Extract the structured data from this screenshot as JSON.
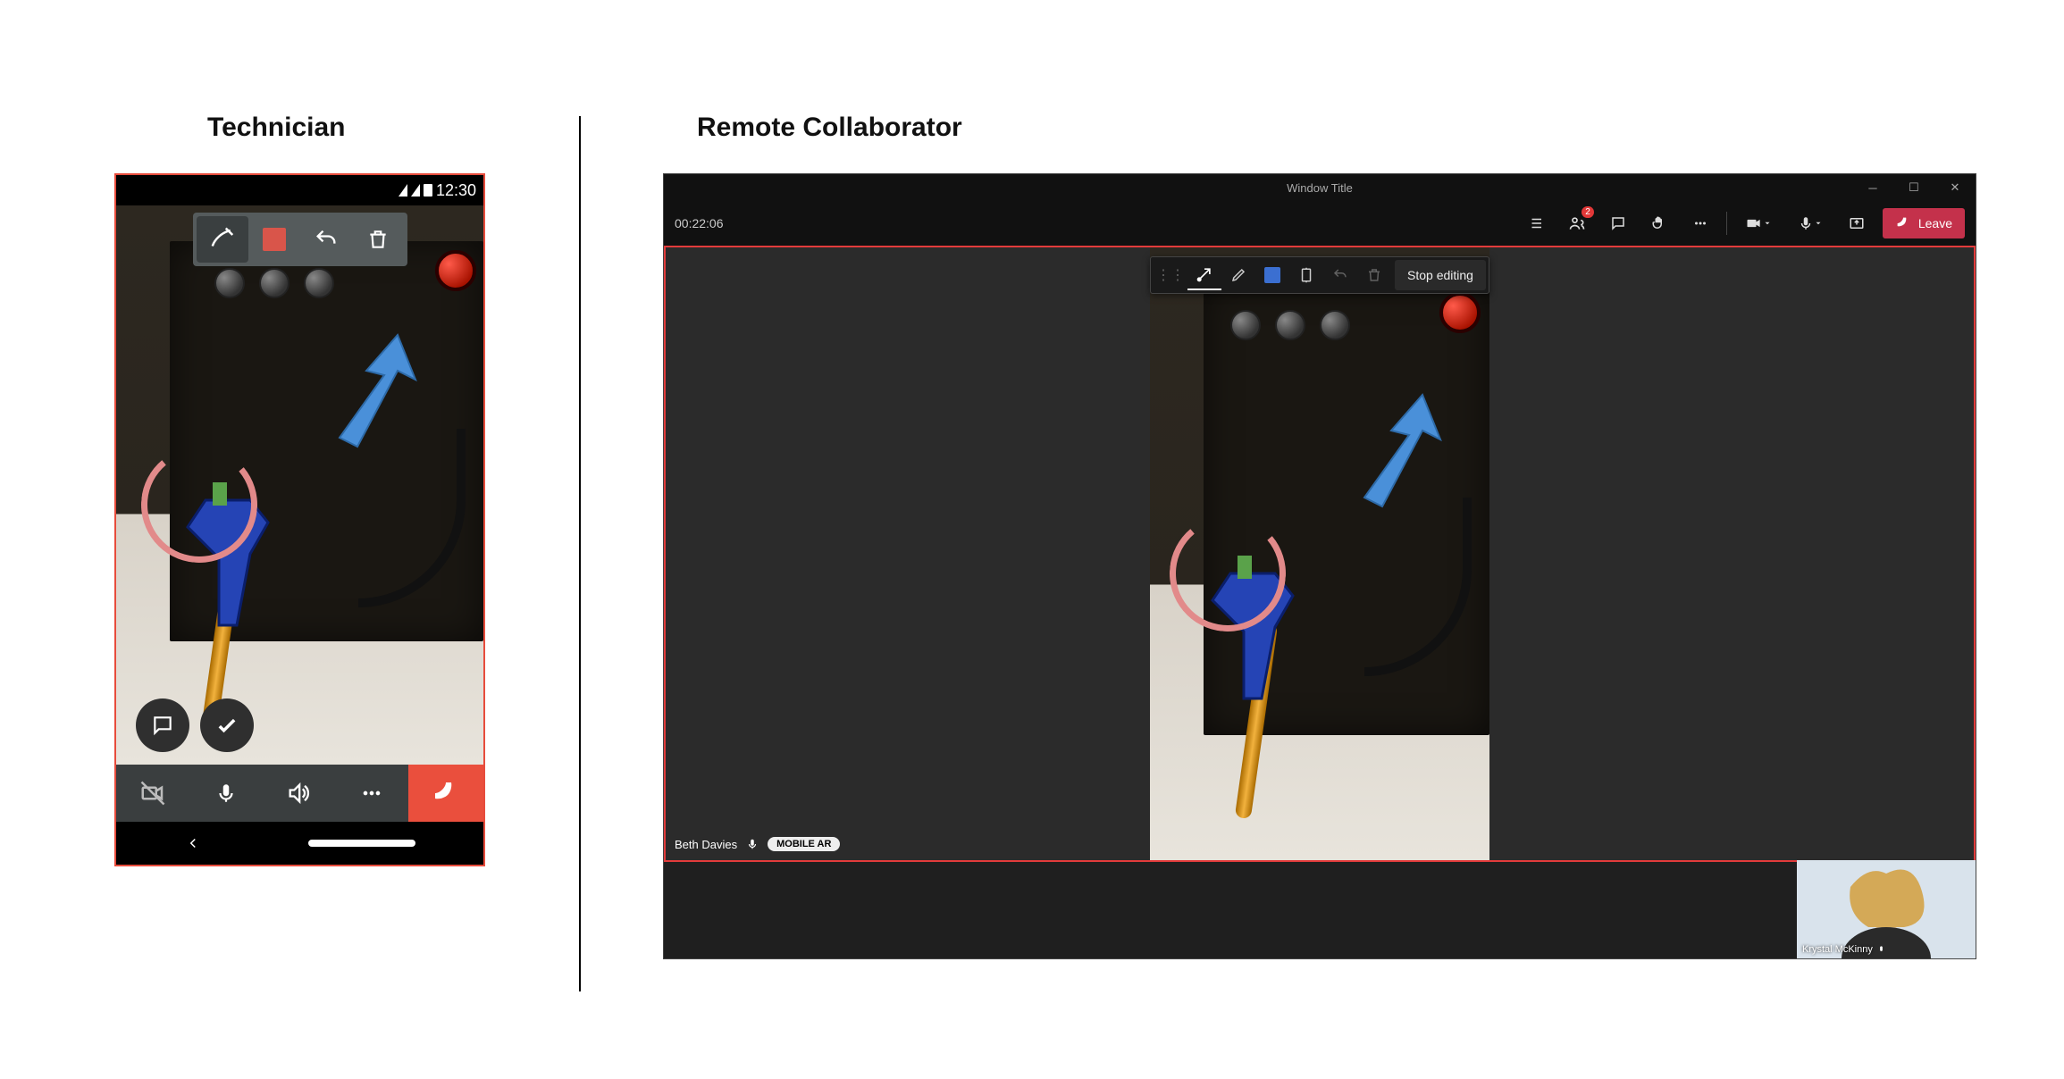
{
  "labels": {
    "technician": "Technician",
    "collaborator": "Remote Collaborator"
  },
  "phone": {
    "status_time": "12:30",
    "annotation_color": "#d9554a"
  },
  "teams": {
    "window_title": "Window Title",
    "call_time": "00:22:06",
    "badge_count": "2",
    "leave_label": "Leave",
    "stop_editing": "Stop editing",
    "edit_color": "#3b6fd1",
    "participant_name": "Beth Davies",
    "participant_badge": "MOBILE AR",
    "pip_name": "Krystal McKinny"
  }
}
